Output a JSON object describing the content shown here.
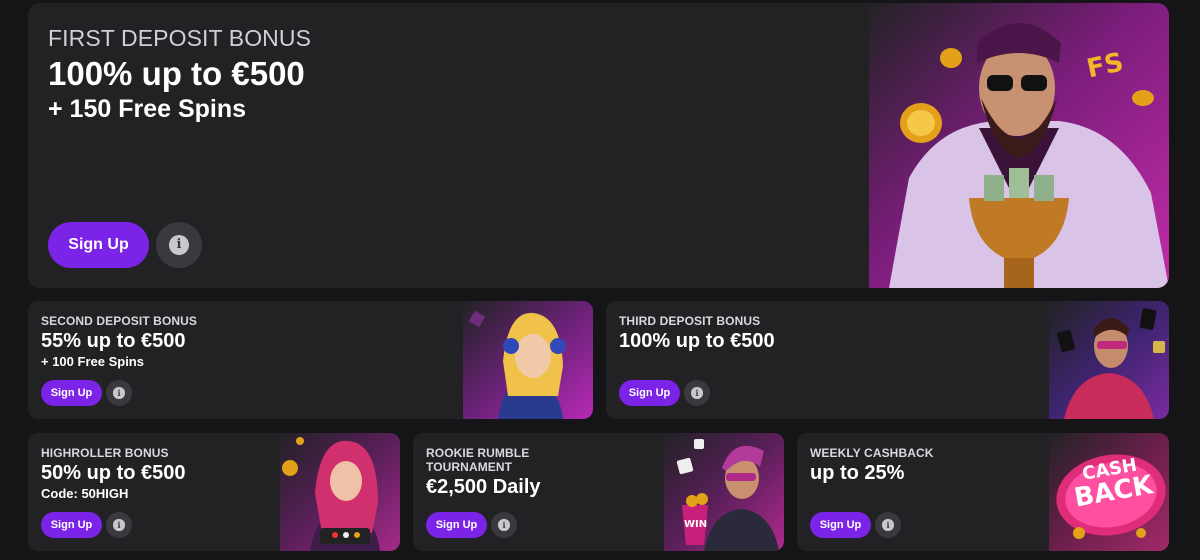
{
  "promos": {
    "first": {
      "eyebrow": "FIRST DEPOSIT BONUS",
      "headline": "100% up to €500",
      "subline": "+ 150 Free Spins",
      "signup_label": "Sign Up",
      "info_icon": "info-icon"
    },
    "second": {
      "eyebrow": "SECOND DEPOSIT BONUS",
      "headline": "55% up to €500",
      "subline": "+ 100 Free Spins",
      "signup_label": "Sign Up",
      "info_icon": "info-icon"
    },
    "third": {
      "eyebrow": "THIRD DEPOSIT BONUS",
      "headline": "100% up to €500",
      "signup_label": "Sign Up",
      "info_icon": "info-icon"
    },
    "highroller": {
      "eyebrow": "HIGHROLLER BONUS",
      "headline": "50% up to €500",
      "subline": "Code: 50HIGH",
      "signup_label": "Sign Up",
      "info_icon": "info-icon"
    },
    "rookie": {
      "eyebrow_line1": "ROOKIE RUMBLE",
      "eyebrow_line2": "TOURNAMENT",
      "headline": "€2,500 Daily",
      "signup_label": "Sign Up",
      "info_icon": "info-icon"
    },
    "cashback": {
      "eyebrow": "WEEKLY CASHBACK",
      "headline": "up to 25%",
      "signup_label": "Sign Up",
      "info_icon": "info-icon"
    }
  },
  "artwork": {
    "hero_badge": "FS",
    "rookie_badge": "WIN",
    "cashback_badge_line1": "CASH",
    "cashback_badge_line2": "BACK"
  },
  "colors": {
    "accent": "#7b23e6",
    "card_bg": "#222225",
    "page_bg": "#151517",
    "art_magenta": "#b62ab5"
  }
}
